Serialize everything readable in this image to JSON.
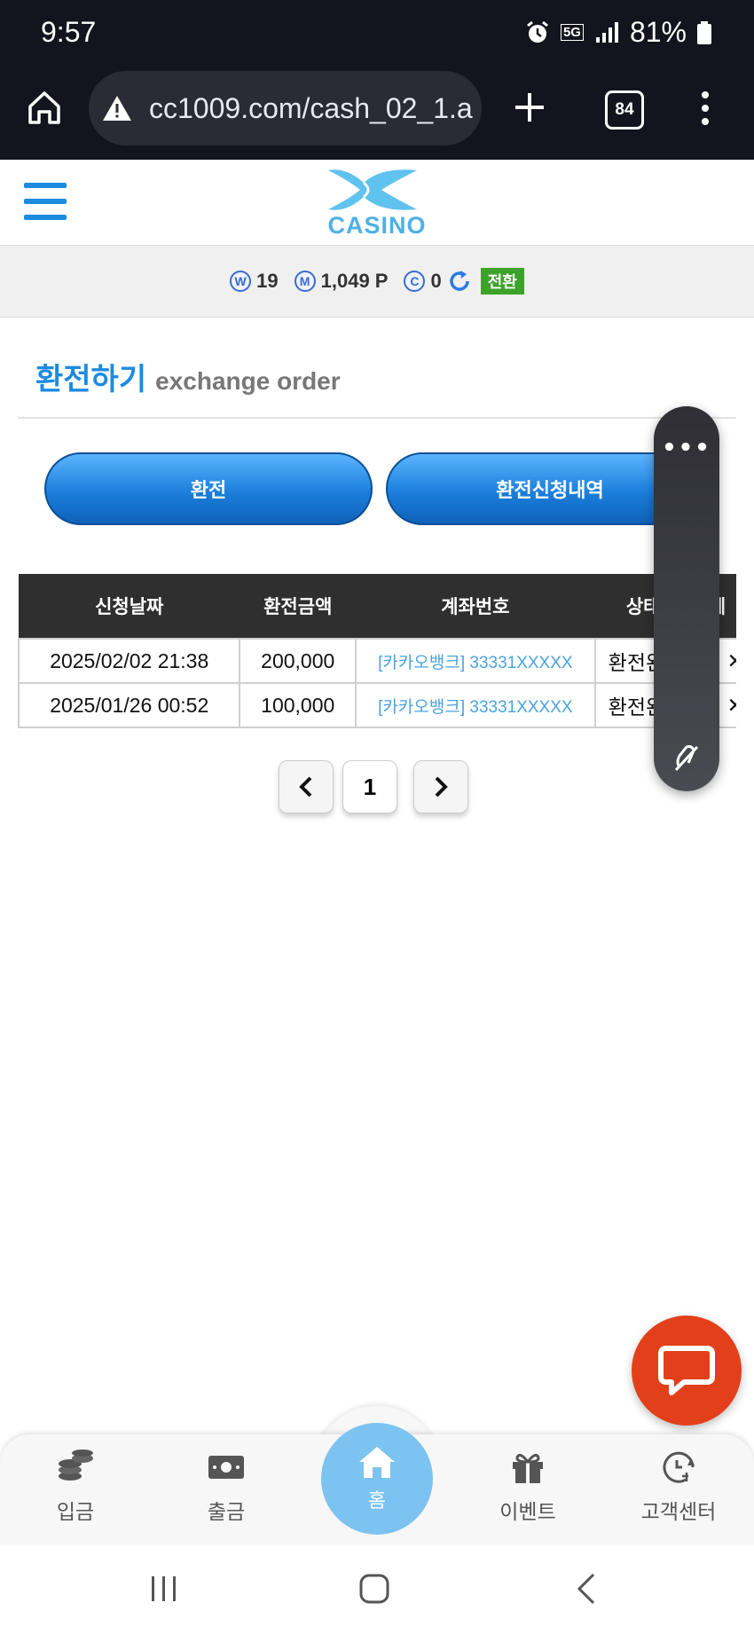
{
  "status_bar": {
    "time": "9:57",
    "network": "5G",
    "battery": "81%"
  },
  "browser": {
    "url": "cc1009.com/cash_02_1.a",
    "tab_count": "84"
  },
  "site": {
    "logo_text": "CASINO",
    "balances": [
      {
        "icon": "W",
        "value": "19"
      },
      {
        "icon": "M",
        "value": "1,049 P"
      },
      {
        "icon": "C",
        "value": "0"
      }
    ],
    "convert_label": "전환"
  },
  "page": {
    "title_ko": "환전하기",
    "title_en": "exchange order",
    "buttons": {
      "exchange": "환전",
      "history": "환전신청내역"
    }
  },
  "table": {
    "headers": [
      "신청날짜",
      "환전금액",
      "계좌번호",
      "상태",
      "삭제"
    ],
    "rows": [
      {
        "date": "2025/02/02 21:38",
        "amount": "200,000",
        "account": "[카카오뱅크] 33331XXXXX",
        "status": "환전완료"
      },
      {
        "date": "2025/01/26 00:52",
        "amount": "100,000",
        "account": "[카카오뱅크] 33331XXXXX",
        "status": "환전완료"
      }
    ]
  },
  "pagination": {
    "current": "1"
  },
  "bottom_nav": {
    "deposit": "입금",
    "withdraw": "출금",
    "home": "홈",
    "event": "이벤트",
    "support": "고객센터"
  },
  "colors": {
    "accent": "#1d8be0",
    "chat": "#e2401a",
    "header_dark": "#2f2f2f"
  }
}
